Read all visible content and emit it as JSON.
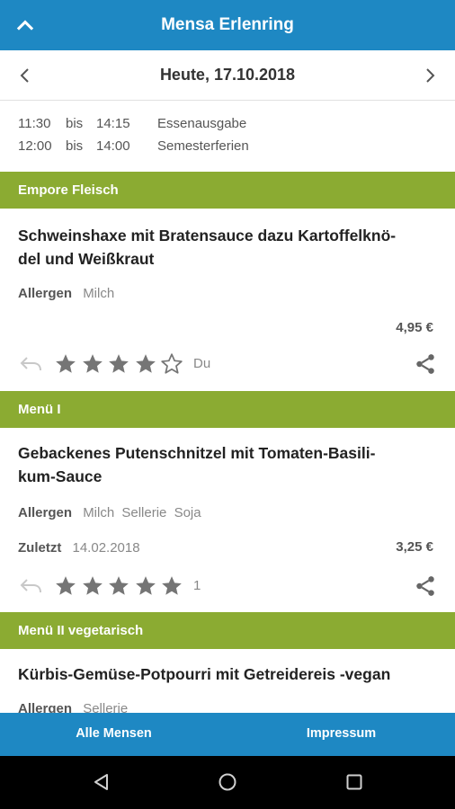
{
  "appbar": {
    "title": "Mensa Erlenring",
    "up_icon": "chevron-up-icon"
  },
  "datebar": {
    "date": "Heute, 17.10.2018",
    "prev_icon": "chevron-left-icon",
    "next_icon": "chevron-right-icon"
  },
  "hours": [
    {
      "from": "11:30",
      "sep": "bis",
      "to": "14:15",
      "desc": "Essenausgabe"
    },
    {
      "from": "12:00",
      "sep": "bis",
      "to": "14:00",
      "desc": "Semesterferien"
    }
  ],
  "sections": [
    {
      "title": "Empore Fleisch",
      "meal": {
        "name_line1": "Schweinshaxe mit Bratensauce dazu Kartoffelknö-",
        "name_line2": "del und Weißkraut",
        "allergen_label": "Allergen",
        "allergens": [
          "Milch"
        ],
        "price": "4,95 €",
        "rating": 4,
        "rating_text": "Du"
      }
    },
    {
      "title": "Menü I",
      "meal": {
        "name_line1": "Gebackenes Putenschnitzel mit Tomaten-Basili-",
        "name_line2": "kum-Sauce",
        "allergen_label": "Allergen",
        "allergens": [
          "Milch",
          "Sellerie",
          "Soja"
        ],
        "last_label": "Zuletzt",
        "last_date": "14.02.2018",
        "price": "3,25 €",
        "rating": 5,
        "rating_text": "1"
      }
    },
    {
      "title": "Menü II vegetarisch",
      "meal": {
        "name_line1": "Kürbis-Gemüse-Potpourri mit Getreidereis -vegan",
        "allergen_label": "Allergen",
        "allergens": [
          "Sellerie"
        ]
      }
    }
  ],
  "bottombar": {
    "left": "Alle Mensen",
    "right": "Impressum"
  },
  "colors": {
    "primary": "#1e88c3",
    "section": "#8bab32",
    "star": "#757575"
  }
}
